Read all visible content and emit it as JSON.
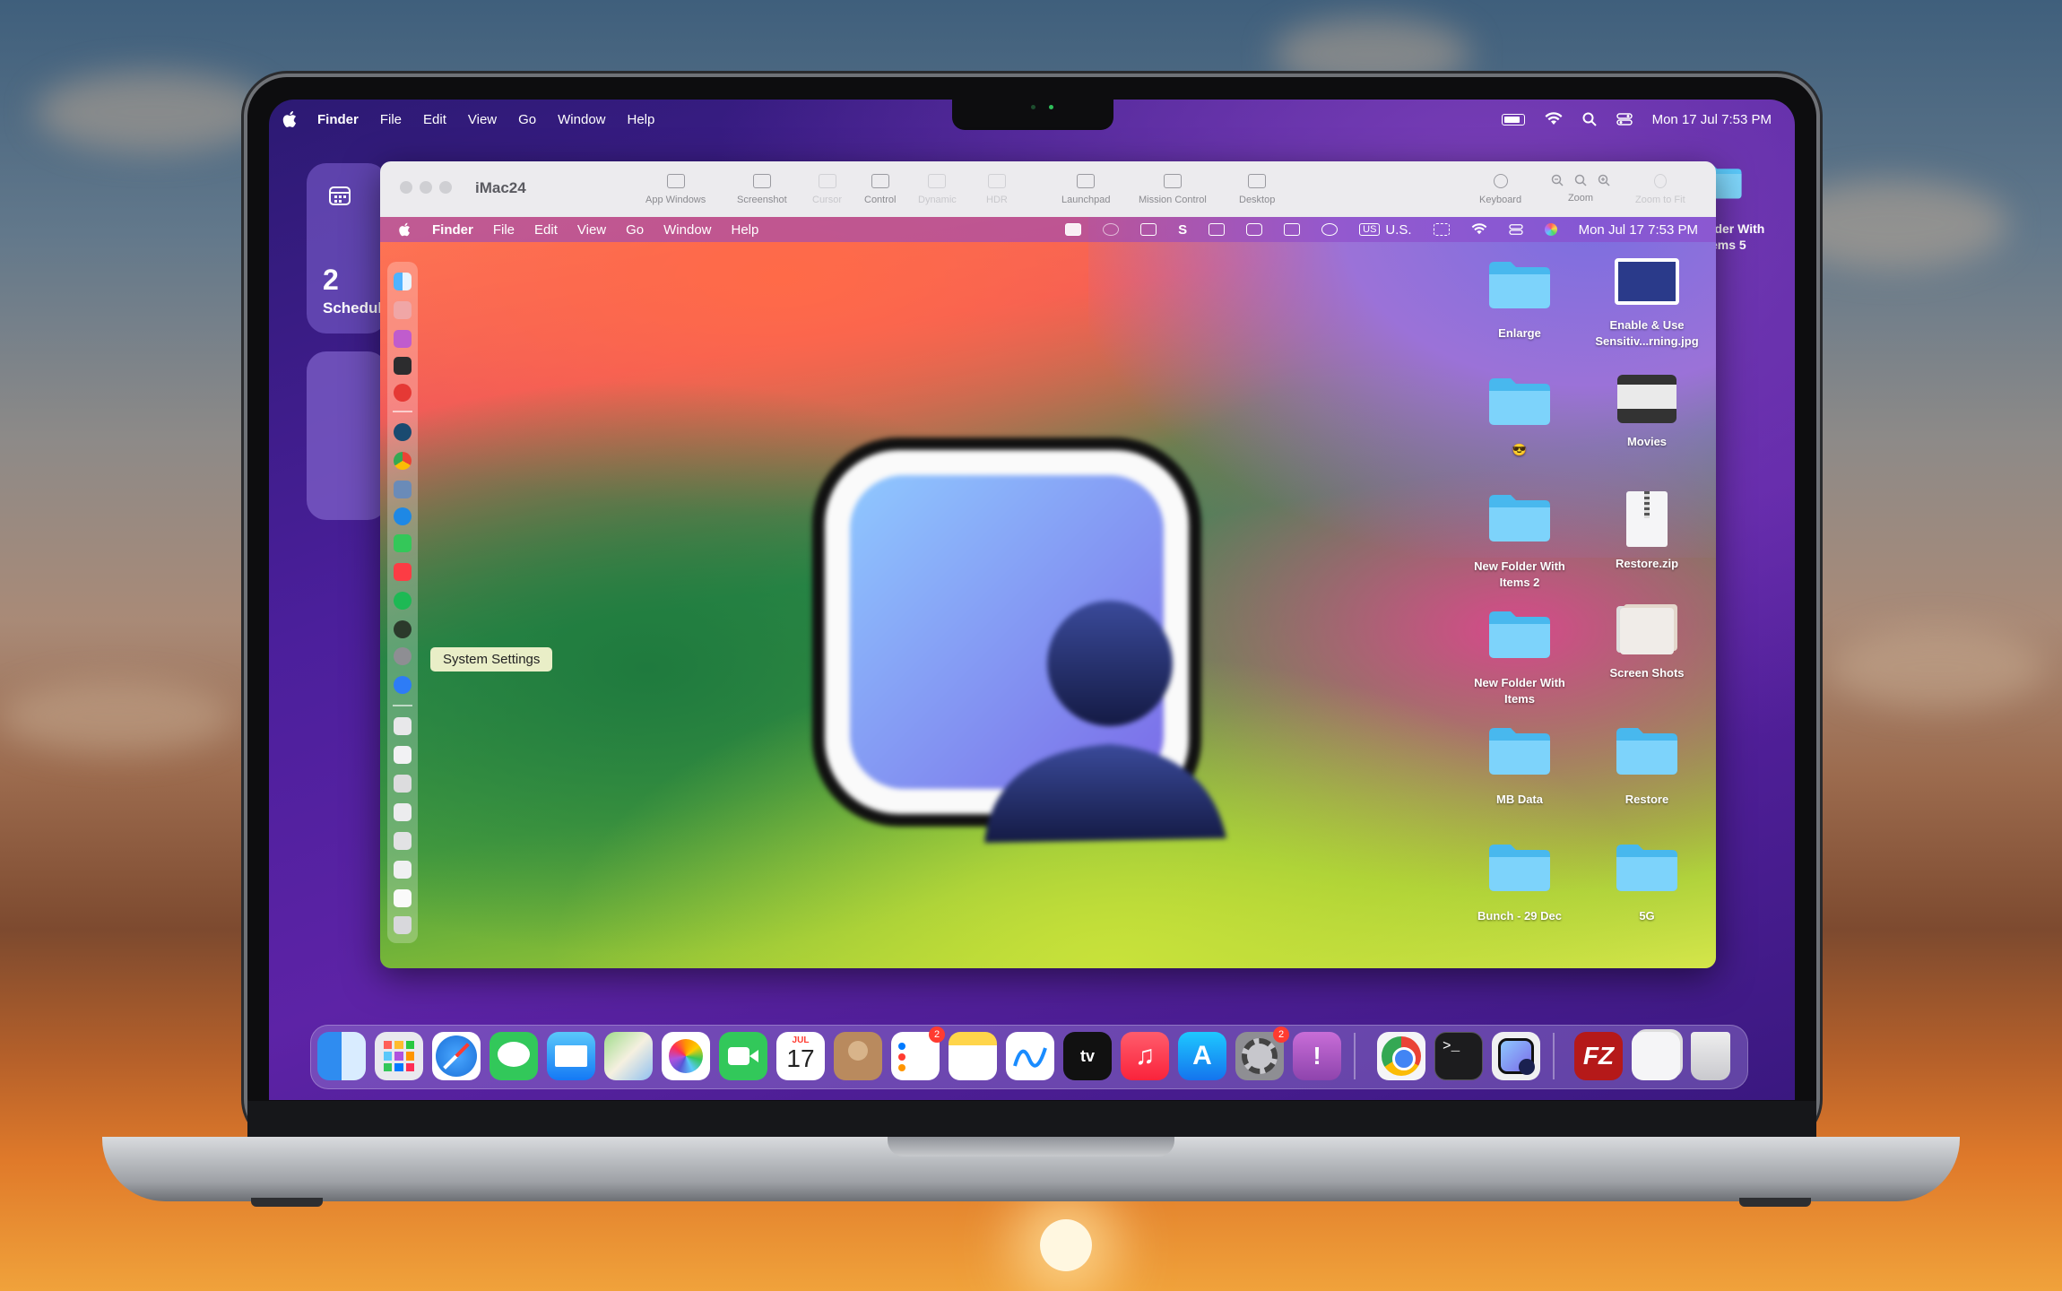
{
  "menubar": {
    "app": "Finder",
    "items": [
      "File",
      "Edit",
      "View",
      "Go",
      "Window",
      "Help"
    ],
    "clock": "Mon 17 Jul  7:53 PM"
  },
  "widget": {
    "count": "2",
    "label": "Schedul"
  },
  "right_edge_folder": {
    "label_line1": "older With",
    "label_line2": "ems 5"
  },
  "window": {
    "title": "iMac24",
    "toolbar": [
      {
        "label": "App Windows",
        "icon": "app-windows-icon",
        "dim": false
      },
      {
        "label": "Screenshot",
        "icon": "camera-icon",
        "dim": false
      },
      {
        "label": "Cursor",
        "icon": "cursor-icon",
        "dim": true
      },
      {
        "label": "Control",
        "icon": "control-icon",
        "dim": false
      },
      {
        "label": "Dynamic",
        "icon": "dynamic-icon",
        "dim": true
      },
      {
        "label": "HDR",
        "icon": "hdr-icon",
        "dim": true
      },
      {
        "label": "Launchpad",
        "icon": "launchpad-icon",
        "dim": false
      },
      {
        "label": "Mission Control",
        "icon": "mission-control-icon",
        "dim": false
      },
      {
        "label": "Desktop",
        "icon": "desktop-icon",
        "dim": false
      },
      {
        "label": "Keyboard",
        "icon": "globe-icon",
        "dim": false
      },
      {
        "label": "Zoom",
        "icon": "zoom-icon",
        "dim": false
      },
      {
        "label": "Zoom to Fit",
        "icon": "zoom-fit-icon",
        "dim": true
      }
    ],
    "inner_menubar": {
      "app": "Finder",
      "items": [
        "File",
        "Edit",
        "View",
        "Go",
        "Window",
        "Help"
      ],
      "input": "U.S.",
      "input_badge": "US",
      "clock": "Mon Jul 17  7:53 PM"
    },
    "tooltip": "System Settings",
    "desktop_icons": [
      {
        "label": "Enlarge",
        "type": "folder"
      },
      {
        "label": "Enable & Use Sensitiv...rning.jpg",
        "type": "image"
      },
      {
        "label": "😎",
        "type": "folder"
      },
      {
        "label": "Movies",
        "type": "movies"
      },
      {
        "label": "New Folder With Items 2",
        "type": "folder"
      },
      {
        "label": "Restore.zip",
        "type": "zip"
      },
      {
        "label": "New Folder With Items",
        "type": "folder"
      },
      {
        "label": "Screen Shots",
        "type": "stack"
      },
      {
        "label": "MB Data",
        "type": "folder"
      },
      {
        "label": "Restore",
        "type": "folder"
      },
      {
        "label": "Bunch - 29 Dec",
        "type": "folder"
      },
      {
        "label": "5G",
        "type": "folder"
      }
    ]
  },
  "dock": {
    "apps": [
      {
        "name": "Finder",
        "icon": "finder-icon"
      },
      {
        "name": "Launchpad",
        "icon": "launchpad-icon"
      },
      {
        "name": "Safari",
        "icon": "safari-icon"
      },
      {
        "name": "Messages",
        "icon": "messages-icon"
      },
      {
        "name": "Mail",
        "icon": "mail-icon"
      },
      {
        "name": "Maps",
        "icon": "maps-icon"
      },
      {
        "name": "Photos",
        "icon": "photos-icon"
      },
      {
        "name": "FaceTime",
        "icon": "facetime-icon"
      },
      {
        "name": "Calendar",
        "icon": "calendar-icon"
      },
      {
        "name": "Contacts",
        "icon": "contacts-icon"
      },
      {
        "name": "Reminders",
        "icon": "reminders-icon"
      },
      {
        "name": "Notes",
        "icon": "notes-icon"
      },
      {
        "name": "Freeform",
        "icon": "freeform-icon"
      },
      {
        "name": "TV",
        "icon": "tv-icon"
      },
      {
        "name": "Music",
        "icon": "music-icon"
      },
      {
        "name": "App Store",
        "icon": "app-store-icon"
      },
      {
        "name": "System Settings",
        "icon": "system-settings-icon"
      },
      {
        "name": "Feedback Assistant",
        "icon": "feedback-icon"
      },
      {
        "name": "Chrome",
        "icon": "chrome-icon"
      },
      {
        "name": "Terminal",
        "icon": "terminal-icon"
      },
      {
        "name": "Screen Sharing",
        "icon": "screen-sharing-icon"
      },
      {
        "name": "FileZilla",
        "icon": "filezilla-icon"
      },
      {
        "name": "Downloads",
        "icon": "downloads-stack-icon"
      },
      {
        "name": "Trash",
        "icon": "trash-icon"
      }
    ],
    "calendar_month": "JUL",
    "calendar_day": "17",
    "reminders_badge": "2",
    "settings_badge": "2",
    "tv_label": "tv",
    "filezilla_label": "FZ"
  },
  "colors": {
    "folder": "#5ac8fa",
    "menubar_text": "#ffffff",
    "tooltip_bg": "#e9eec7"
  }
}
